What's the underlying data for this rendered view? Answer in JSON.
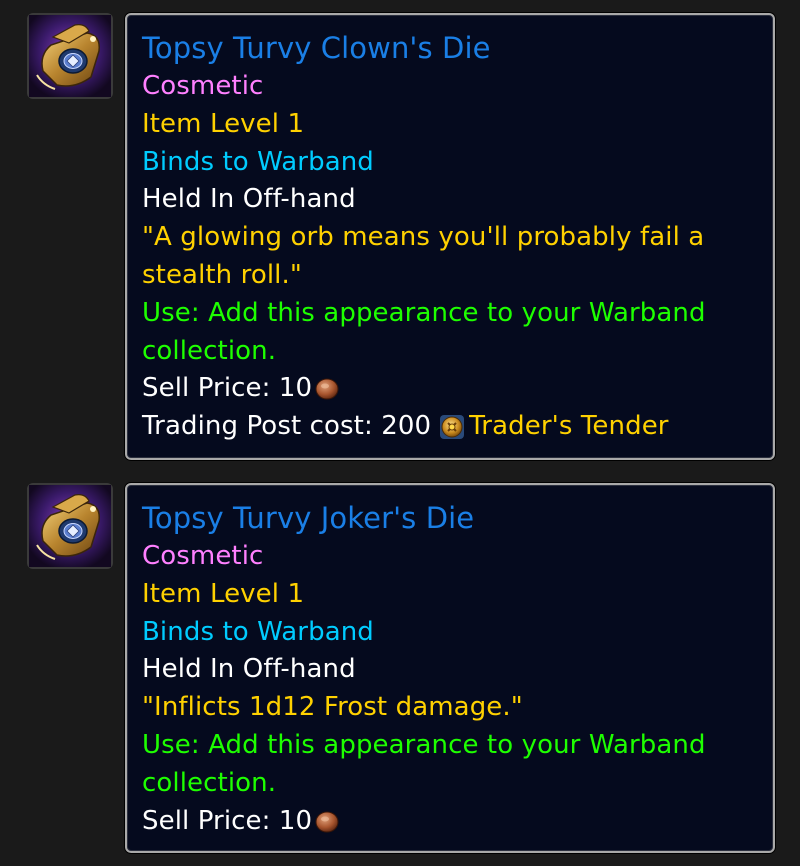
{
  "colors": {
    "title": "#1a7fe6",
    "cosmetic": "#ff80ff",
    "item_level": "#ffd100",
    "binds": "#00ccff",
    "white": "#ffffff",
    "flavor": "#ffd100",
    "use": "#1eff00",
    "currency": "#ffd100"
  },
  "tooltips": [
    {
      "icon": "dice-pouch-icon",
      "title": "Topsy Turvy Clown's Die",
      "cosmetic": "Cosmetic",
      "item_level": "Item Level 1",
      "binds": "Binds to Warband",
      "slot": "Held In Off-hand",
      "flavor": "\"A glowing orb means you'll probably fail a stealth roll.\"",
      "use": "Use: Add this appearance to your Warband collection.",
      "sell_price_label": "Sell Price:",
      "sell_price_value": "10",
      "sell_price_icon": "copper-coin-icon",
      "trading_post_label": "Trading Post cost:",
      "trading_post_value": "200",
      "trading_post_icon": "traders-tender-icon",
      "trading_post_currency": "Trader's Tender"
    },
    {
      "icon": "dice-pouch-icon",
      "title": "Topsy Turvy Joker's Die",
      "cosmetic": "Cosmetic",
      "item_level": "Item Level 1",
      "binds": "Binds to Warband",
      "slot": "Held In Off-hand",
      "flavor": "\"Inflicts 1d12 Frost damage.\"",
      "use": "Use: Add this appearance to your Warband collection.",
      "sell_price_label": "Sell Price:",
      "sell_price_value": "10",
      "sell_price_icon": "copper-coin-icon"
    }
  ]
}
